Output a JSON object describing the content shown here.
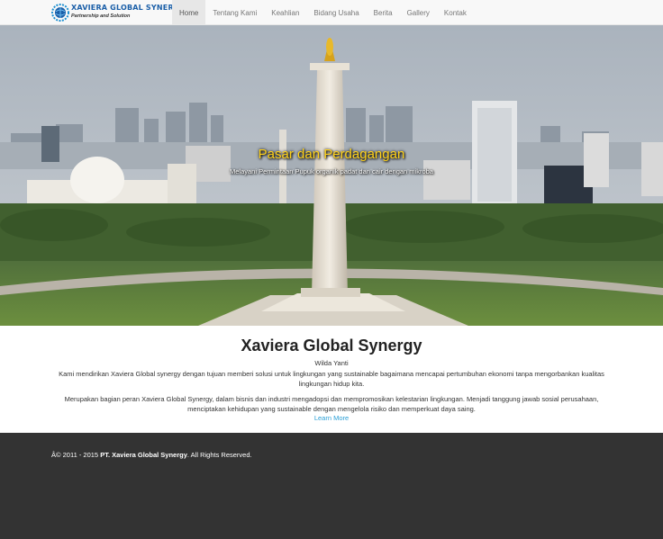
{
  "brand": {
    "name": "XAVIERA GLOBAL SYNERGY",
    "tagline": "Partnership and Solution",
    "logo_icon": "globe-gear-logo"
  },
  "nav": {
    "items": [
      {
        "label": "Home",
        "active": true
      },
      {
        "label": "Tentang Kami",
        "active": false
      },
      {
        "label": "Keahlian",
        "active": false
      },
      {
        "label": "Bidang Usaha",
        "active": false
      },
      {
        "label": "Berita",
        "active": false
      },
      {
        "label": "Gallery",
        "active": false
      },
      {
        "label": "Kontak",
        "active": false
      }
    ]
  },
  "hero": {
    "title": "Pasar dan Perdagangan",
    "subtitle": "Melayani Permintaan Pupuk organik padat dan cair dengan mikroba"
  },
  "about": {
    "heading": "Xaviera Global Synergy",
    "author": "Wilda Yanti",
    "paragraph1": "Kami  mendirikan Xaviera Global synergy dengan  tujuan memberi solusi untuk  lingkungan yang sustainable bagaimana mencapai pertumbuhan ekonomi tanpa mengorbankan kualitas lingkungan hidup kita.",
    "paragraph2": "Merupakan bagian peran  Xaviera Global Synergy, dalam  bisnis dan industri  mengadopsi dan mempromosikan kelestarian lingkungan. Menjadi  tanggung jawab sosial perusahaan,  menciptakan  kehidupan yang sustainable  dengan  mengelola risiko dan memperkuat daya saing.",
    "learn_more": "Learn More"
  },
  "footer": {
    "copyright_prefix": "Â© 2011 - 2015 ",
    "company": "PT. Xaviera Global Synergy",
    "suffix": ". All Rights Reserved."
  },
  "colors": {
    "navbar_bg": "#f8f8f8",
    "active_tab_bg": "#e7e7e7",
    "hero_title": "#ffd21a",
    "link": "#2a9fd6",
    "footer_bg": "#333333"
  }
}
